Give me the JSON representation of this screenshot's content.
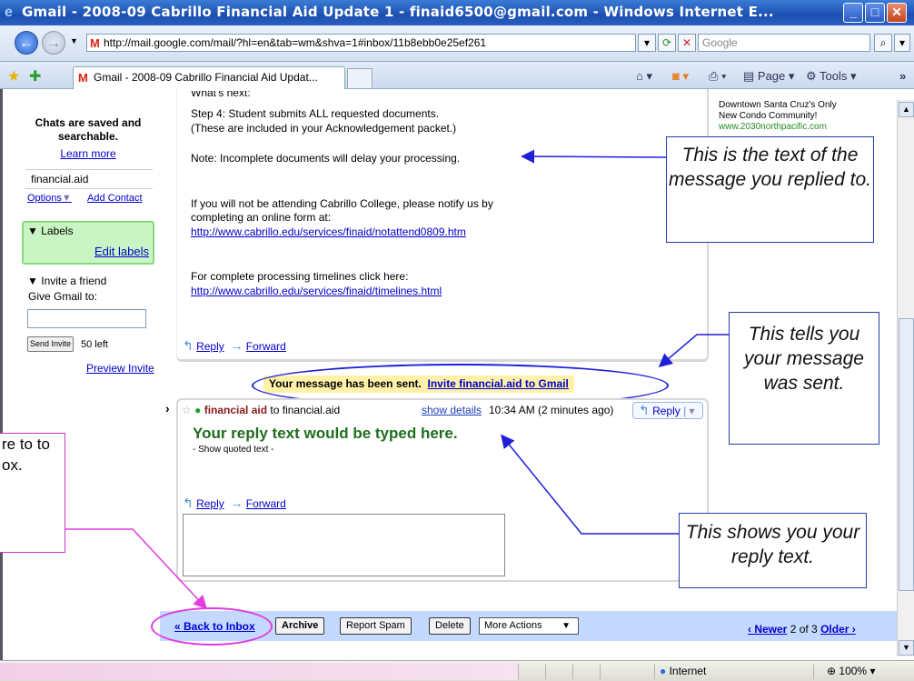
{
  "window": {
    "title": "Gmail - 2008-09 Cabrillo Financial Aid Update 1 - finaid6500@gmail.com - Windows Internet E...",
    "url": "http://mail.google.com/mail/?hl=en&tab=wm&shva=1#inbox/11b8ebb0e25ef261",
    "search_placeholder": "Google",
    "tab_label": "Gmail - 2008-09 Cabrillo Financial Aid Updat...",
    "page_menu": "Page",
    "tools_menu": "Tools"
  },
  "sidebar": {
    "chats_saved": "Chats are saved and searchable.",
    "learn_more": "Learn more",
    "contact": "financial.aid",
    "options": "Options",
    "add_contact": "Add Contact",
    "labels_title": "Labels",
    "edit_labels": "Edit labels",
    "invite_title": "Invite a friend",
    "give_gmail": "Give Gmail to:",
    "send_invite": "Send Invite",
    "invites_left": "50 left",
    "preview_invite": "Preview Invite"
  },
  "message1": {
    "line1": "What's next:",
    "line2": "Step 4: Student submits ALL requested documents.",
    "line3": "(These are included in your Acknowledgement packet.)",
    "note": "Note: Incomplete documents will delay your processing.",
    "notify1": "If you will not be attending Cabrillo College, please notify us by",
    "notify2": "completing an online form at:",
    "link1": "http://www.cabrillo.edu/services/finaid/notattend0809.htm",
    "timelines": "For complete processing timelines click here:",
    "link2": "http://www.cabrillo.edu/services/finaid/timelines.html",
    "reply": "Reply",
    "forward": "Forward"
  },
  "sent_banner": {
    "text": "Your message has been sent.",
    "invite_link": "Invite financial.aid to Gmail"
  },
  "message2": {
    "sender": "financial aid",
    "to": "to financial.aid",
    "show_details": "show details",
    "time": "10:34 AM (2 minutes ago)",
    "reply_btn": "Reply",
    "body": "Your reply text would be typed here.",
    "show_quoted": "- Show quoted text -",
    "reply": "Reply",
    "forward": "Forward"
  },
  "bottom_bar": {
    "back_to_inbox": "« Back to Inbox",
    "archive": "Archive",
    "report_spam": "Report Spam",
    "delete": "Delete",
    "more_actions": "More Actions",
    "newer": "‹ Newer",
    "position": "2 of 3",
    "older": "Older ›"
  },
  "ad": {
    "line1": "Downtown Santa Cruz's Only",
    "line2": "New Condo Community!",
    "url": "www.2030northpacific.com"
  },
  "callouts": {
    "replied_to": "This is the text of the message you replied to.",
    "was_sent": "This tells you your message was sent.",
    "reply_text": "This shows you your reply text.",
    "left_partial": "re to to ox."
  },
  "status": {
    "zone": "Internet",
    "zoom": "100%"
  },
  "colors": {
    "labels_bg": "#c9f5c4",
    "bottom_bar_bg": "#c3d9ff",
    "sent_banner_bg": "#fff1a8",
    "reply_body": "#1e6e1e",
    "annotation_blue": "#1f3fa8",
    "annotation_magenta": "#e03ce0"
  }
}
